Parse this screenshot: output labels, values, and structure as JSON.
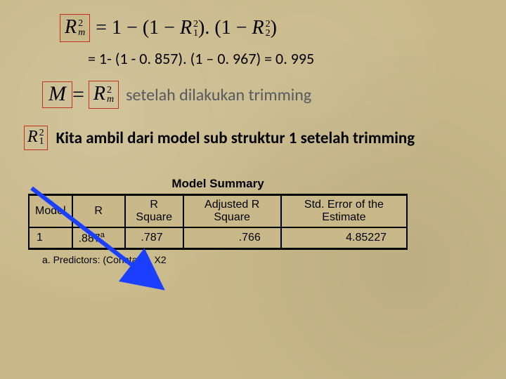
{
  "formula1": {
    "lhs_var": "R",
    "lhs_sup": "2",
    "lhs_sub": "m",
    "rhs_text": "= 1 − (1 − R₁²).(1 − R₂²)"
  },
  "numeric_line": "= 1- (1 - 0. 857). (1 – 0. 967) = 0. 995",
  "m_line": {
    "lhs": "M",
    "eq": " = ",
    "rhs_var": "R",
    "rhs_sup": "2",
    "rhs_sub": "m",
    "trailing": " setelah dilakukan trimming"
  },
  "r1_line": {
    "var": "R",
    "sup": "2",
    "sub": "1",
    "text": "Kita ambil dari model sub struktur 1  setelah trimming"
  },
  "table": {
    "title": "Model Summary",
    "headers": [
      "Model",
      "R",
      "R Square",
      "Adjusted R Square",
      "Std. Error of the Estimate"
    ],
    "row": {
      "model": "1",
      "r": ".887",
      "r_sup": "a",
      "rsq": ".787",
      "adjrsq": ".766",
      "stderr": "4.85227"
    },
    "footnote": "a. Predictors: (Constant), X2"
  },
  "chart_data": {
    "type": "table",
    "title": "Model Summary",
    "columns": [
      "Model",
      "R",
      "R Square",
      "Adjusted R Square",
      "Std. Error of the Estimate"
    ],
    "rows": [
      {
        "Model": 1,
        "R": 0.887,
        "R Square": 0.787,
        "Adjusted R Square": 0.766,
        "Std. Error of the Estimate": 4.85227
      }
    ],
    "footnote": "a. Predictors: (Constant), X2"
  }
}
